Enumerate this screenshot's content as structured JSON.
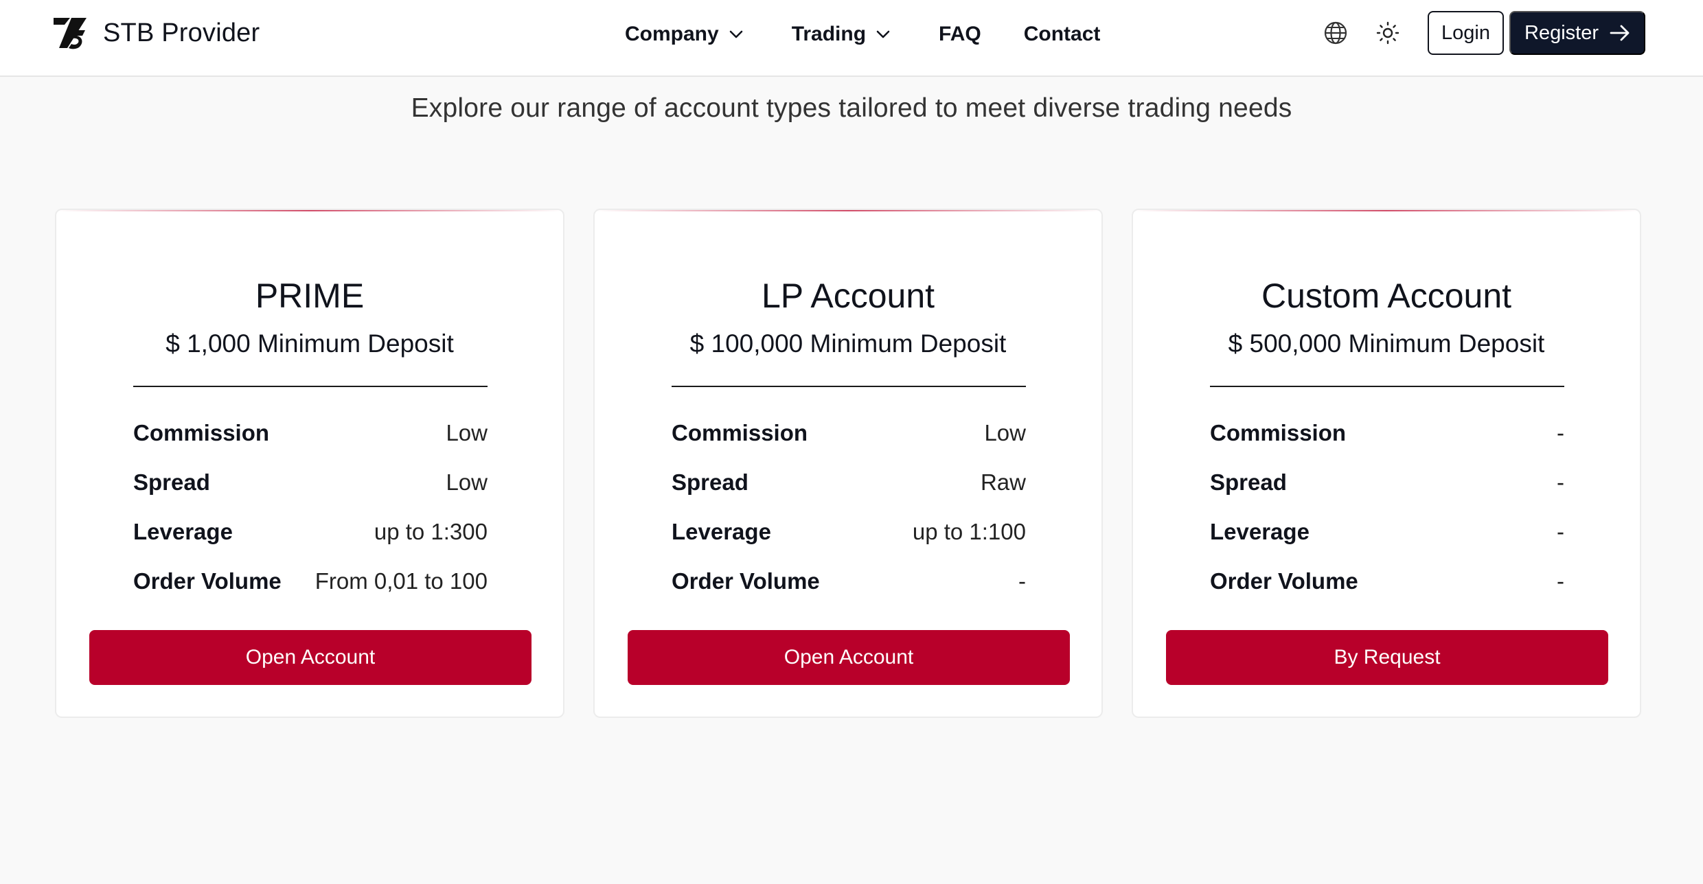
{
  "header": {
    "brand_name": "STB Provider",
    "nav": [
      {
        "label": "Company",
        "has_dropdown": true
      },
      {
        "label": "Trading",
        "has_dropdown": true
      },
      {
        "label": "FAQ",
        "has_dropdown": false
      },
      {
        "label": "Contact",
        "has_dropdown": false
      }
    ],
    "icons": {
      "language": "globe-icon",
      "theme": "sun-icon"
    },
    "login_label": "Login",
    "register_label": "Register"
  },
  "intro": {
    "text": "Explore our range of account types tailored to meet diverse trading needs"
  },
  "cards": [
    {
      "title": "PRIME",
      "deposit": "$ 1,000 Minimum Deposit",
      "specs": [
        {
          "label": "Commission",
          "value": "Low"
        },
        {
          "label": "Spread",
          "value": "Low"
        },
        {
          "label": "Leverage",
          "value": "up to 1:300"
        },
        {
          "label": "Order Volume",
          "value": "From 0,01 to 100"
        }
      ],
      "cta": "Open Account"
    },
    {
      "title": "LP Account",
      "deposit": "$ 100,000 Minimum Deposit",
      "specs": [
        {
          "label": "Commission",
          "value": "Low"
        },
        {
          "label": "Spread",
          "value": "Raw"
        },
        {
          "label": "Leverage",
          "value": "up to 1:100"
        },
        {
          "label": "Order Volume",
          "value": "-"
        }
      ],
      "cta": "Open Account"
    },
    {
      "title": "Custom Account",
      "deposit": "$ 500,000 Minimum Deposit",
      "specs": [
        {
          "label": "Commission",
          "value": "-"
        },
        {
          "label": "Spread",
          "value": "-"
        },
        {
          "label": "Leverage",
          "value": "-"
        },
        {
          "label": "Order Volume",
          "value": "-"
        }
      ],
      "cta": "By Request"
    }
  ],
  "colors": {
    "accent": "#b8002a",
    "dark": "#0f172a",
    "background": "#f9f9f9"
  }
}
